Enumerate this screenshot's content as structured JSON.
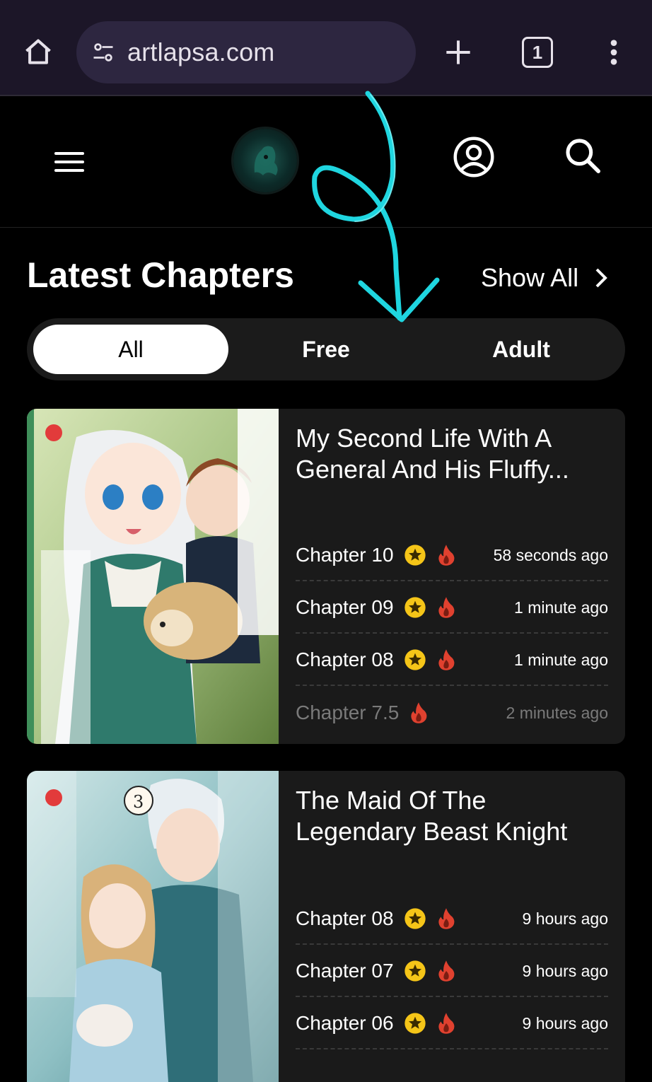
{
  "browser": {
    "url": "artlapsa.com",
    "tab_count": "1"
  },
  "site": {
    "section_title": "Latest Chapters",
    "show_all": "Show All",
    "filters": [
      "All",
      "Free",
      "Adult"
    ],
    "active_filter": "All"
  },
  "cards": [
    {
      "title": "My Second Life With A General And His Fluffy...",
      "chapters": [
        {
          "name": "Chapter 10",
          "time": "58 seconds ago",
          "star": true,
          "fire": true,
          "dim": false
        },
        {
          "name": "Chapter 09",
          "time": "1 minute ago",
          "star": true,
          "fire": true,
          "dim": false
        },
        {
          "name": "Chapter 08",
          "time": "1 minute ago",
          "star": true,
          "fire": true,
          "dim": false
        },
        {
          "name": "Chapter 7.5",
          "time": "2 minutes ago",
          "star": false,
          "fire": true,
          "dim": true
        }
      ]
    },
    {
      "title": "The Maid Of The Legendary Beast Knight",
      "chapters": [
        {
          "name": "Chapter 08",
          "time": "9 hours ago",
          "star": true,
          "fire": true,
          "dim": false
        },
        {
          "name": "Chapter 07",
          "time": "9 hours ago",
          "star": true,
          "fire": true,
          "dim": false
        },
        {
          "name": "Chapter 06",
          "time": "9 hours ago",
          "star": true,
          "fire": true,
          "dim": false
        }
      ]
    }
  ],
  "colors": {
    "browser_bg": "#1c1628",
    "url_pill": "#2d2640",
    "page_bg": "#000000",
    "card_bg": "#1a1a1a",
    "star_yellow": "#f5c518",
    "fire_red": "#e0412f",
    "annotation_cyan": "#1fd6e0"
  },
  "icons": [
    "home-icon",
    "site-info-icon",
    "plus-icon",
    "tabs-icon",
    "more-vert-icon",
    "hamburger-icon",
    "site-logo",
    "account-icon",
    "search-icon",
    "chevron-right-icon",
    "star-icon",
    "fire-icon"
  ]
}
